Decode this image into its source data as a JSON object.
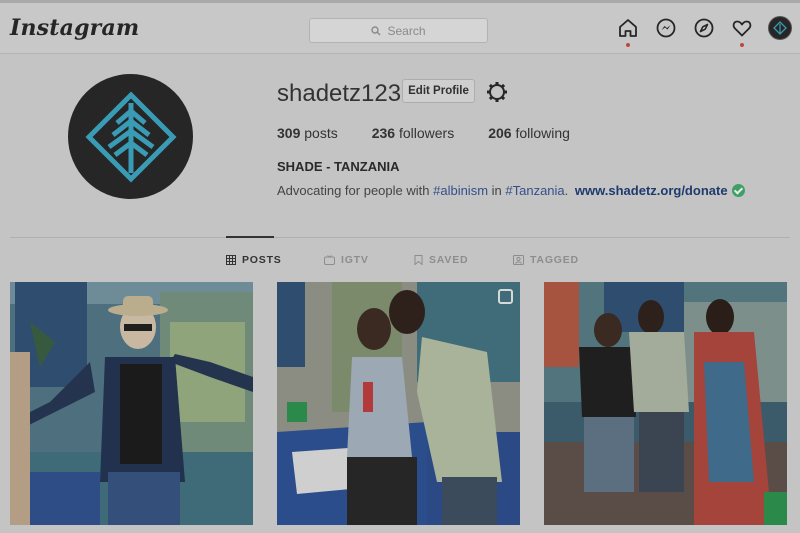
{
  "nav": {
    "logo": "Instagram",
    "search_placeholder": "Search",
    "icons": [
      "home-icon",
      "messenger-icon",
      "explore-icon",
      "activity-heart-icon",
      "profile-avatar"
    ]
  },
  "profile": {
    "username": "shadetz123",
    "edit_label": "Edit Profile",
    "stats": [
      {
        "num": "309",
        "label": " posts"
      },
      {
        "num": "236",
        "label": " followers"
      },
      {
        "num": "206",
        "label": " following"
      }
    ],
    "full_name": "SHADE - TANZANIA",
    "bio_prefix": "Advocating for people with ",
    "bio_tag1": "#albinism",
    "bio_mid": " in ",
    "bio_tag2": "#Tanzania",
    "bio_suffix": ".",
    "link": "www.shadetz.org/donate"
  },
  "tabs": [
    {
      "label": "POSTS",
      "icon": "grid-icon",
      "active": true
    },
    {
      "label": "IGTV",
      "icon": "igtv-icon",
      "active": false
    },
    {
      "label": "SAVED",
      "icon": "bookmark-icon",
      "active": false
    },
    {
      "label": "TAGGED",
      "icon": "tagged-icon",
      "active": false
    }
  ],
  "posts": [
    {
      "alt": "photo-man-in-hat"
    },
    {
      "alt": "photo-signing-document"
    },
    {
      "alt": "photo-group-discussion"
    }
  ],
  "colors": {
    "accent": "#34508a",
    "notification": "#c4453f",
    "logo_teal": "#3a9bb5"
  }
}
